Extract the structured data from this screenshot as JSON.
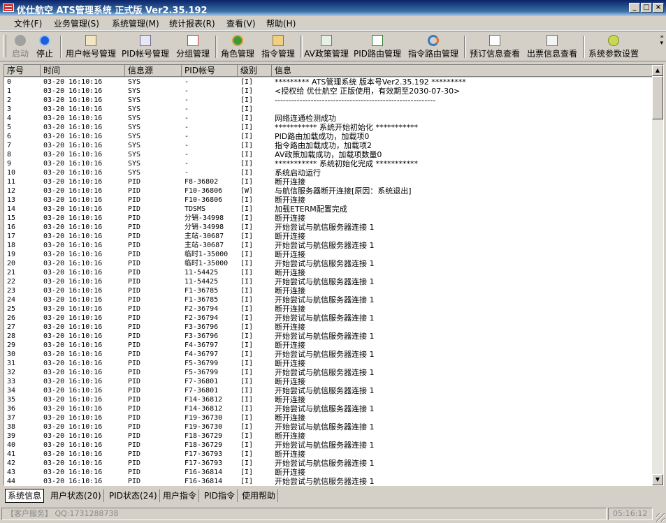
{
  "window": {
    "title": "优仕航空 ATS管理系统 正式版 Ver2.35.192"
  },
  "menu": [
    "文件(F)",
    "业务管理(S)",
    "系统管理(M)",
    "统计报表(R)",
    "查看(V)",
    "帮助(H)"
  ],
  "toolbar": [
    {
      "label": "启动",
      "icon": "play-icon",
      "disabled": true
    },
    {
      "label": "停止",
      "icon": "stop-icon"
    },
    {
      "label": "用户帐号管理",
      "icon": "user-account-icon"
    },
    {
      "label": "PID帐号管理",
      "icon": "pid-account-icon"
    },
    {
      "label": "分组管理",
      "icon": "group-icon"
    },
    {
      "label": "角色管理",
      "icon": "role-icon"
    },
    {
      "label": "指令管理",
      "icon": "command-icon"
    },
    {
      "label": "AV政策管理",
      "icon": "av-policy-icon"
    },
    {
      "label": "PID路由管理",
      "icon": "pid-route-icon"
    },
    {
      "label": "指令路由管理",
      "icon": "command-route-icon"
    },
    {
      "label": "预订信息查看",
      "icon": "booking-info-icon"
    },
    {
      "label": "出票信息查看",
      "icon": "ticket-info-icon"
    },
    {
      "label": "系统参数设置",
      "icon": "settings-icon"
    }
  ],
  "grid": {
    "columns": [
      "序号",
      "时间",
      "信息源",
      "PID帐号",
      "级别",
      "信息"
    ],
    "rows": [
      [
        "0",
        "03-20 16:10:16",
        "SYS",
        "-",
        "[I]",
        "********* ATS管理系统 版本号Ver2.35.192 *********"
      ],
      [
        "1",
        "03-20 16:10:16",
        "SYS",
        "-",
        "[I]",
        "<授权给 优仕航空 正版使用，有效期至2030-07-30>"
      ],
      [
        "2",
        "03-20 16:10:16",
        "SYS",
        "-",
        "[I]",
        "----------------------------------------------------------"
      ],
      [
        "3",
        "03-20 16:10:16",
        "SYS",
        "-",
        "[I]",
        ""
      ],
      [
        "4",
        "03-20 16:10:16",
        "SYS",
        "-",
        "[I]",
        "网络连通检测成功"
      ],
      [
        "5",
        "03-20 16:10:16",
        "SYS",
        "-",
        "[I]",
        "*********** 系统开始初始化 ***********"
      ],
      [
        "6",
        "03-20 16:10:16",
        "SYS",
        "-",
        "[I]",
        "PID路由加载成功，加载项0"
      ],
      [
        "7",
        "03-20 16:10:16",
        "SYS",
        "-",
        "[I]",
        "指令路由加载成功，加载项2"
      ],
      [
        "8",
        "03-20 16:10:16",
        "SYS",
        "-",
        "[I]",
        "AV政策加载成功，加载项数量0"
      ],
      [
        "9",
        "03-20 16:10:16",
        "SYS",
        "-",
        "[I]",
        "*********** 系统初始化完成 ***********"
      ],
      [
        "10",
        "03-20 16:10:16",
        "SYS",
        "-",
        "[I]",
        "系统启动运行"
      ],
      [
        "11",
        "03-20 16:10:16",
        "PID",
        "F8-36802",
        "[I]",
        "断开连接"
      ],
      [
        "12",
        "03-20 16:10:16",
        "PID",
        "F10-36806",
        "[W]",
        "与航信服务器断开连接[原因：系统退出]"
      ],
      [
        "13",
        "03-20 16:10:16",
        "PID",
        "F10-36806",
        "[I]",
        "断开连接"
      ],
      [
        "14",
        "03-20 16:10:16",
        "PID",
        "TDSMS",
        "[I]",
        "加载ETERM配置完成"
      ],
      [
        "15",
        "03-20 16:10:16",
        "PID",
        "分销-34998",
        "[I]",
        "断开连接"
      ],
      [
        "16",
        "03-20 16:10:16",
        "PID",
        "分销-34998",
        "[I]",
        "开始尝试与航信服务器连接 1"
      ],
      [
        "17",
        "03-20 16:10:16",
        "PID",
        "主站-30687",
        "[I]",
        "断开连接"
      ],
      [
        "18",
        "03-20 16:10:16",
        "PID",
        "主站-30687",
        "[I]",
        "开始尝试与航信服务器连接 1"
      ],
      [
        "19",
        "03-20 16:10:16",
        "PID",
        "临时1-35000",
        "[I]",
        "断开连接"
      ],
      [
        "20",
        "03-20 16:10:16",
        "PID",
        "临时1-35000",
        "[I]",
        "开始尝试与航信服务器连接 1"
      ],
      [
        "21",
        "03-20 16:10:16",
        "PID",
        "11-54425",
        "[I]",
        "断开连接"
      ],
      [
        "22",
        "03-20 16:10:16",
        "PID",
        "11-54425",
        "[I]",
        "开始尝试与航信服务器连接 1"
      ],
      [
        "23",
        "03-20 16:10:16",
        "PID",
        "F1-36785",
        "[I]",
        "断开连接"
      ],
      [
        "24",
        "03-20 16:10:16",
        "PID",
        "F1-36785",
        "[I]",
        "开始尝试与航信服务器连接 1"
      ],
      [
        "25",
        "03-20 16:10:16",
        "PID",
        "F2-36794",
        "[I]",
        "断开连接"
      ],
      [
        "26",
        "03-20 16:10:16",
        "PID",
        "F2-36794",
        "[I]",
        "开始尝试与航信服务器连接 1"
      ],
      [
        "27",
        "03-20 16:10:16",
        "PID",
        "F3-36796",
        "[I]",
        "断开连接"
      ],
      [
        "28",
        "03-20 16:10:16",
        "PID",
        "F3-36796",
        "[I]",
        "开始尝试与航信服务器连接 1"
      ],
      [
        "29",
        "03-20 16:10:16",
        "PID",
        "F4-36797",
        "[I]",
        "断开连接"
      ],
      [
        "30",
        "03-20 16:10:16",
        "PID",
        "F4-36797",
        "[I]",
        "开始尝试与航信服务器连接 1"
      ],
      [
        "31",
        "03-20 16:10:16",
        "PID",
        "F5-36799",
        "[I]",
        "断开连接"
      ],
      [
        "32",
        "03-20 16:10:16",
        "PID",
        "F5-36799",
        "[I]",
        "开始尝试与航信服务器连接 1"
      ],
      [
        "33",
        "03-20 16:10:16",
        "PID",
        "F7-36801",
        "[I]",
        "断开连接"
      ],
      [
        "34",
        "03-20 16:10:16",
        "PID",
        "F7-36801",
        "[I]",
        "开始尝试与航信服务器连接 1"
      ],
      [
        "35",
        "03-20 16:10:16",
        "PID",
        "F14-36812",
        "[I]",
        "断开连接"
      ],
      [
        "36",
        "03-20 16:10:16",
        "PID",
        "F14-36812",
        "[I]",
        "开始尝试与航信服务器连接 1"
      ],
      [
        "37",
        "03-20 16:10:16",
        "PID",
        "F19-36730",
        "[I]",
        "断开连接"
      ],
      [
        "38",
        "03-20 16:10:16",
        "PID",
        "F19-36730",
        "[I]",
        "开始尝试与航信服务器连接 1"
      ],
      [
        "39",
        "03-20 16:10:16",
        "PID",
        "F18-36729",
        "[I]",
        "断开连接"
      ],
      [
        "40",
        "03-20 16:10:16",
        "PID",
        "F18-36729",
        "[I]",
        "开始尝试与航信服务器连接 1"
      ],
      [
        "41",
        "03-20 16:10:16",
        "PID",
        "F17-36793",
        "[I]",
        "断开连接"
      ],
      [
        "42",
        "03-20 16:10:16",
        "PID",
        "F17-36793",
        "[I]",
        "开始尝试与航信服务器连接 1"
      ],
      [
        "43",
        "03-20 16:10:16",
        "PID",
        "F16-36814",
        "[I]",
        "断开连接"
      ],
      [
        "44",
        "03-20 16:10:16",
        "PID",
        "F16-36814",
        "[I]",
        "开始尝试与航信服务器连接 1"
      ]
    ]
  },
  "tabs": [
    "系统信息",
    "用户状态(20)",
    "PID状态(24)",
    "用户指令",
    "PID指令",
    "使用帮助"
  ],
  "status": {
    "service": "【客户服务】 QQ:1731288738",
    "time": "05:16:12"
  }
}
